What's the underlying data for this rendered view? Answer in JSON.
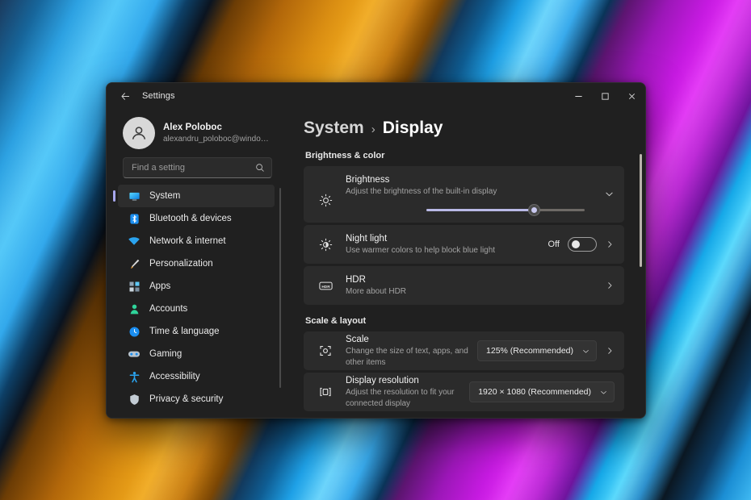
{
  "window": {
    "title": "Settings",
    "back_icon": "back-arrow-icon",
    "minimize_label": "—",
    "maximize_label": "❐",
    "close_label": "✕"
  },
  "account": {
    "name": "Alex Poloboc",
    "email": "alexandru_poloboc@windowsreport...",
    "avatar_icon": "person-avatar-icon"
  },
  "search": {
    "placeholder": "Find a setting",
    "value": "",
    "icon": "search-icon"
  },
  "sidebar": {
    "items": [
      {
        "label": "System",
        "icon": "system-monitor-icon",
        "active": true
      },
      {
        "label": "Bluetooth & devices",
        "icon": "bluetooth-icon",
        "active": false
      },
      {
        "label": "Network & internet",
        "icon": "wifi-icon",
        "active": false
      },
      {
        "label": "Personalization",
        "icon": "paintbrush-icon",
        "active": false
      },
      {
        "label": "Apps",
        "icon": "apps-grid-icon",
        "active": false
      },
      {
        "label": "Accounts",
        "icon": "account-person-icon",
        "active": false
      },
      {
        "label": "Time & language",
        "icon": "clock-icon",
        "active": false
      },
      {
        "label": "Gaming",
        "icon": "gamepad-icon",
        "active": false
      },
      {
        "label": "Accessibility",
        "icon": "accessibility-person-icon",
        "active": false
      },
      {
        "label": "Privacy & security",
        "icon": "shield-icon",
        "active": false
      }
    ]
  },
  "breadcrumb": {
    "root": "System",
    "separator": "›",
    "current": "Display"
  },
  "sections": [
    {
      "title": "Brightness & color",
      "rows": [
        {
          "name": "brightness",
          "icon": "brightness-sun-icon",
          "title": "Brightness",
          "sub": "Adjust the brightness of the built-in display",
          "control": "slider",
          "slider_percent": 68,
          "expand_icon": "chevron-down-icon"
        },
        {
          "name": "night-light",
          "icon": "night-light-icon",
          "title": "Night light",
          "sub": "Use warmer colors to help block blue light",
          "control": "toggle",
          "toggle_state": "Off",
          "chevron_icon": "chevron-right-icon"
        },
        {
          "name": "hdr",
          "icon": "hdr-icon",
          "title": "HDR",
          "sub": "More about HDR",
          "control": "chevron",
          "chevron_icon": "chevron-right-icon"
        }
      ]
    },
    {
      "title": "Scale & layout",
      "rows": [
        {
          "name": "scale",
          "icon": "scale-resize-icon",
          "title": "Scale",
          "sub": "Change the size of text, apps, and other items",
          "control": "dropdown-chevron",
          "dropdown_value": "125% (Recommended)",
          "dropdown_icon": "chevron-down-icon",
          "chevron_icon": "chevron-right-icon"
        },
        {
          "name": "display-resolution",
          "icon": "display-resolution-icon",
          "title": "Display resolution",
          "sub": "Adjust the resolution to fit your connected display",
          "control": "dropdown",
          "dropdown_value": "1920 × 1080 (Recommended)",
          "dropdown_icon": "chevron-down-icon"
        }
      ]
    }
  ],
  "colors": {
    "window_bg": "#202020",
    "card_bg": "#2b2b2b",
    "accent": "#a7a7ee",
    "slider_fill": "#b9b9e6",
    "text_primary": "#f2f2f2",
    "text_secondary": "#a3a3a3"
  }
}
